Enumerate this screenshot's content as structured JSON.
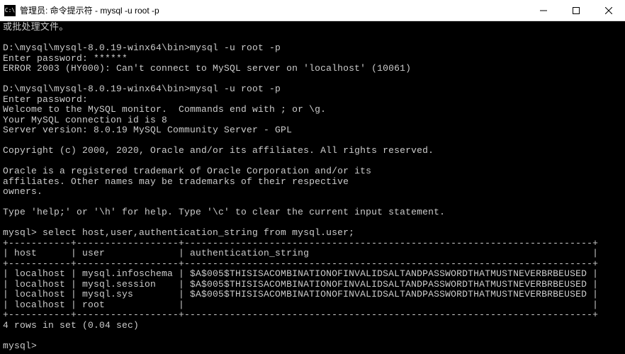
{
  "titlebar": {
    "icon_text": "C:\\",
    "title": "管理员: 命令提示符 - mysql  -u root -p"
  },
  "term": {
    "line0": "或批处理文件。",
    "blank": "",
    "prompt1": "D:\\mysql\\mysql-8.0.19-winx64\\bin>mysql -u root -p",
    "pw1": "Enter password: ******",
    "err1": "ERROR 2003 (HY000): Can't connect to MySQL server on 'localhost' (10061)",
    "prompt2": "D:\\mysql\\mysql-8.0.19-winx64\\bin>mysql -u root -p",
    "pw2": "Enter password:",
    "welcome1": "Welcome to the MySQL monitor.  Commands end with ; or \\g.",
    "welcome2": "Your MySQL connection id is 8",
    "welcome3": "Server version: 8.0.19 MySQL Community Server - GPL",
    "copyright": "Copyright (c) 2000, 2020, Oracle and/or its affiliates. All rights reserved.",
    "oracle1": "Oracle is a registered trademark of Oracle Corporation and/or its",
    "oracle2": "affiliates. Other names may be trademarks of their respective",
    "oracle3": "owners.",
    "help": "Type 'help;' or '\\h' for help. Type '\\c' to clear the current input statement.",
    "query": "mysql> select host,user,authentication_string from mysql.user;",
    "tborder": "+-----------+------------------+------------------------------------------------------------------------+",
    "theader": "| host      | user             | authentication_string                                                  |",
    "trow1": "| localhost | mysql.infoschema | $A$005$THISISACOMBINATIONOFINVALIDSALTANDPASSWORDTHATMUSTNEVERBRBEUSED |",
    "trow2": "| localhost | mysql.session    | $A$005$THISISACOMBINATIONOFINVALIDSALTANDPASSWORDTHATMUSTNEVERBRBEUSED |",
    "trow3": "| localhost | mysql.sys        | $A$005$THISISACOMBINATIONOFINVALIDSALTANDPASSWORDTHATMUSTNEVERBRBEUSED |",
    "trow4": "| localhost | root             |                                                                        |",
    "rows": "4 rows in set (0.04 sec)",
    "prompt3": "mysql> "
  }
}
